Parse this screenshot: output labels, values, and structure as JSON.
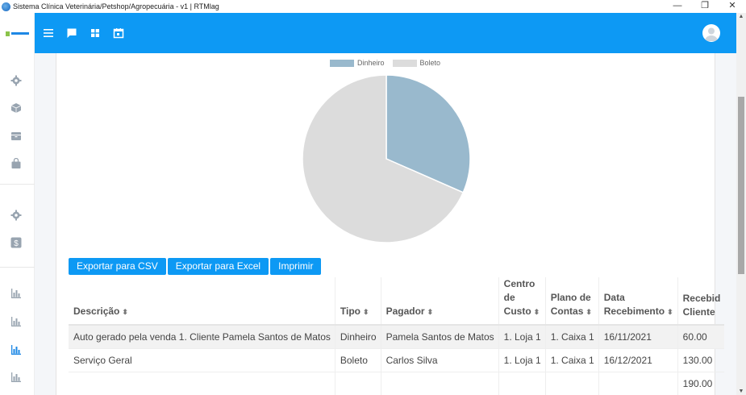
{
  "window": {
    "title": "Sistema Clínica Veterinária/Petshop/Agropecuária - v1 | RTMlag",
    "minimize": "—",
    "restore": "❐",
    "close": "✕"
  },
  "sidebar": {
    "icons": [
      "gear-icon",
      "cube-icon",
      "archive-icon",
      "bag-icon",
      "gear-icon",
      "dollar-icon",
      "bar-chart-icon",
      "bar-chart-icon",
      "bar-chart-icon",
      "bar-chart-icon"
    ],
    "active_index": 8
  },
  "topbar": {
    "icons": [
      "menu-icon",
      "chat-icon",
      "grid-icon",
      "calendar-icon"
    ]
  },
  "colors": {
    "accent": "#0d99f4",
    "dinheiro": "#99b9cd",
    "boleto": "#dcdcdc"
  },
  "chart_data": {
    "type": "pie",
    "legend": [
      "Dinheiro",
      "Boleto"
    ],
    "series": [
      {
        "name": "Dinheiro",
        "value": 60.0
      },
      {
        "name": "Boleto",
        "value": 130.0
      }
    ],
    "legend_position": "top"
  },
  "actions": {
    "csv": "Exportar para CSV",
    "excel": "Exportar para Excel",
    "print": "Imprimir"
  },
  "table": {
    "headers": [
      [
        "Descrição"
      ],
      [
        "Tipo"
      ],
      [
        "Pagador"
      ],
      [
        "Centro",
        "de",
        "Custo"
      ],
      [
        "Plano de",
        "Contas"
      ],
      [
        "Data",
        "Recebimento"
      ],
      [
        "Recebid",
        "Cliente"
      ]
    ],
    "rows": [
      [
        "Auto gerado pela venda 1. Cliente Pamela Santos de Matos",
        "Dinheiro",
        "Pamela Santos de Matos",
        "1. Loja 1",
        "1. Caixa 1",
        "16/11/2021",
        "60.00"
      ],
      [
        "Serviço Geral",
        "Boleto",
        "Carlos Silva",
        "1. Loja 1",
        "1. Caixa 1",
        "16/12/2021",
        "130.00"
      ],
      [
        "",
        "",
        "",
        "",
        "",
        "",
        "190.00"
      ]
    ]
  }
}
